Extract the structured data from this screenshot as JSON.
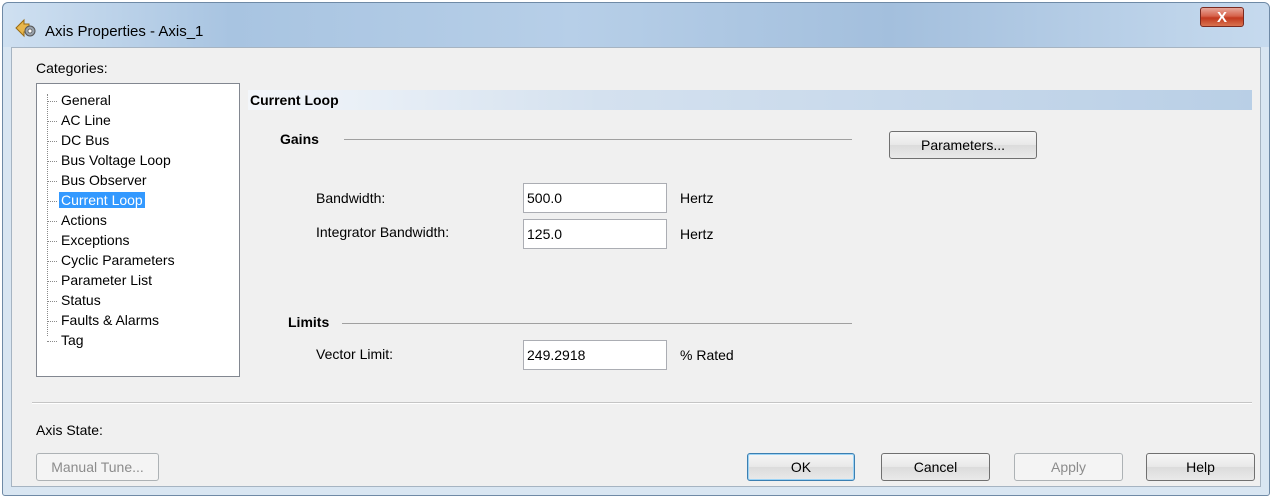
{
  "window": {
    "title": "Axis Properties - Axis_1",
    "close_label": "X"
  },
  "categories": {
    "label": "Categories:",
    "items": [
      {
        "label": "General"
      },
      {
        "label": "AC Line"
      },
      {
        "label": "DC Bus"
      },
      {
        "label": "Bus Voltage Loop"
      },
      {
        "label": "Bus Observer"
      },
      {
        "label": "Current Loop",
        "selected": true
      },
      {
        "label": "Actions"
      },
      {
        "label": "Exceptions"
      },
      {
        "label": "Cyclic Parameters"
      },
      {
        "label": "Parameter List"
      },
      {
        "label": "Status"
      },
      {
        "label": "Faults & Alarms"
      },
      {
        "label": "Tag"
      }
    ]
  },
  "main": {
    "section_title": "Current Loop",
    "gains": {
      "title": "Gains",
      "parameters_button": "Parameters...",
      "bandwidth": {
        "label": "Bandwidth:",
        "value": "500.0",
        "unit": "Hertz"
      },
      "integrator_bandwidth": {
        "label": "Integrator Bandwidth:",
        "value": "125.0",
        "unit": "Hertz"
      }
    },
    "limits": {
      "title": "Limits",
      "vector_limit": {
        "label": "Vector Limit:",
        "value": "249.2918",
        "unit": "% Rated"
      }
    }
  },
  "footer": {
    "axis_state_label": "Axis State:",
    "manual_tune": "Manual Tune...",
    "ok": "OK",
    "cancel": "Cancel",
    "apply": "Apply",
    "help": "Help"
  },
  "colors": {
    "selection": "#3399ff",
    "header_band": "#b9cfe6",
    "close_button": "#c2391f"
  }
}
